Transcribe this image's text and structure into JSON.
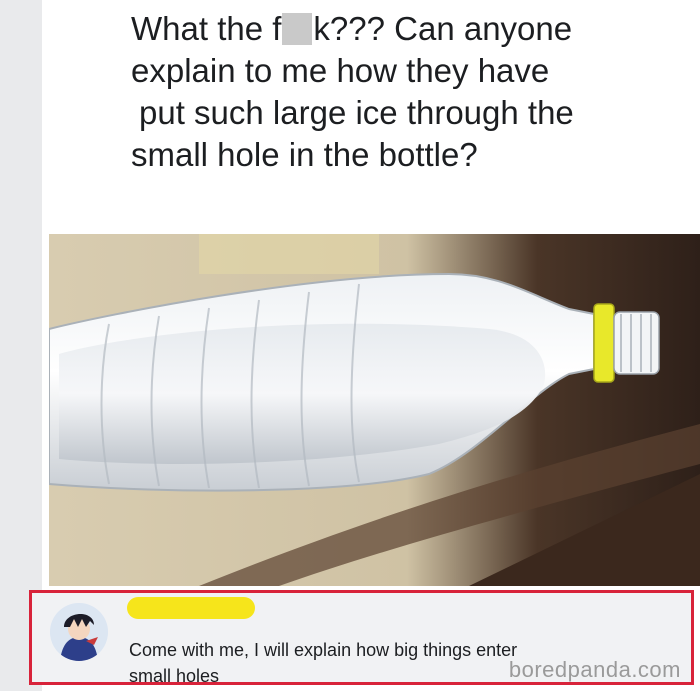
{
  "post": {
    "line1_before": "What the f",
    "line1_after": "k??? Can anyone",
    "line2": "explain to me how they have",
    "line3": "put such large ice through the",
    "line4": "small hole in the bottle?"
  },
  "photo": {
    "subject": "plastic bottle with large ice block inside",
    "cap_color": "#e8e82a"
  },
  "comment": {
    "text_line1": "Come with me, I will explain how big things enter",
    "text_line2": "small holes",
    "name_redaction_color": "#f6e51b",
    "highlight_border_color": "#d8233a"
  },
  "watermark": {
    "text": "boredpanda.com"
  }
}
